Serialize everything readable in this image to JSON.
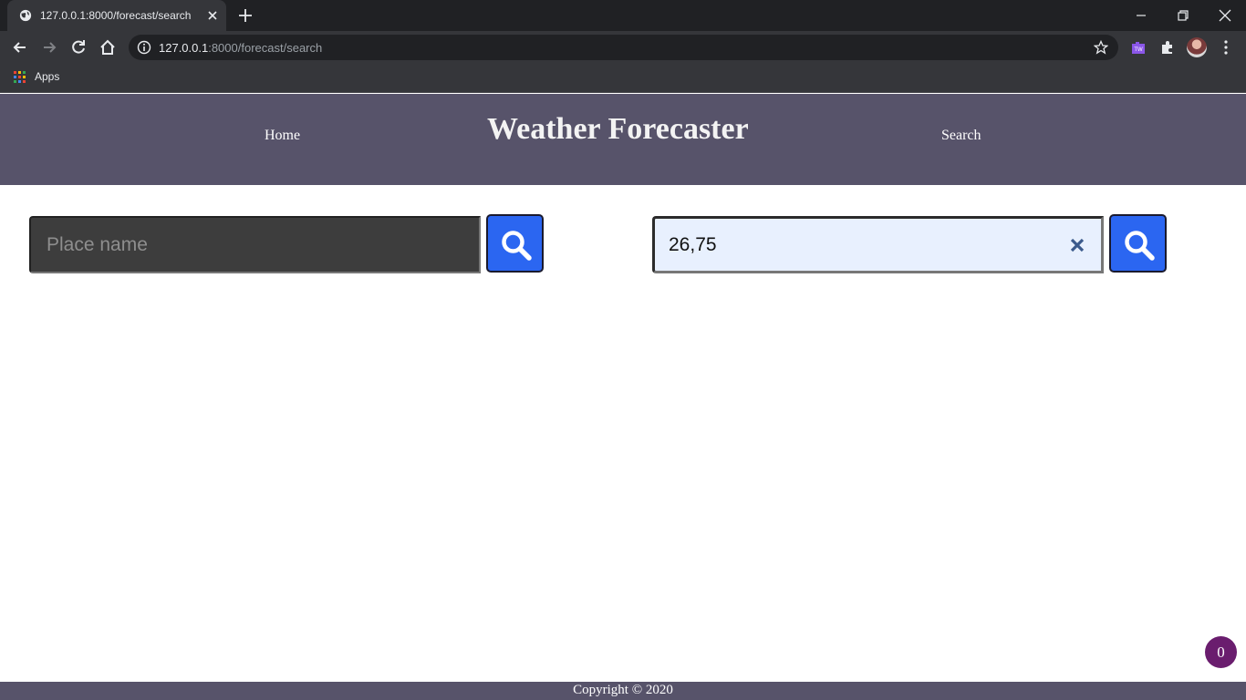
{
  "browser": {
    "tab_title": "127.0.0.1:8000/forecast/search",
    "url_host": "127.0.0.1",
    "url_path": ":8000/forecast/search",
    "bookmark_apps": "Apps"
  },
  "header": {
    "title": "Weather Forecaster",
    "nav_home": "Home",
    "nav_search": "Search"
  },
  "search": {
    "place_placeholder": "Place name",
    "coordinates_value": "26,75"
  },
  "badge": {
    "count": "0"
  },
  "footer": {
    "copyright": "Copyright © 2020"
  },
  "colors": {
    "header_bg": "#57536a",
    "search_button": "#2b66f1",
    "badge_bg": "#6a1d6e"
  }
}
